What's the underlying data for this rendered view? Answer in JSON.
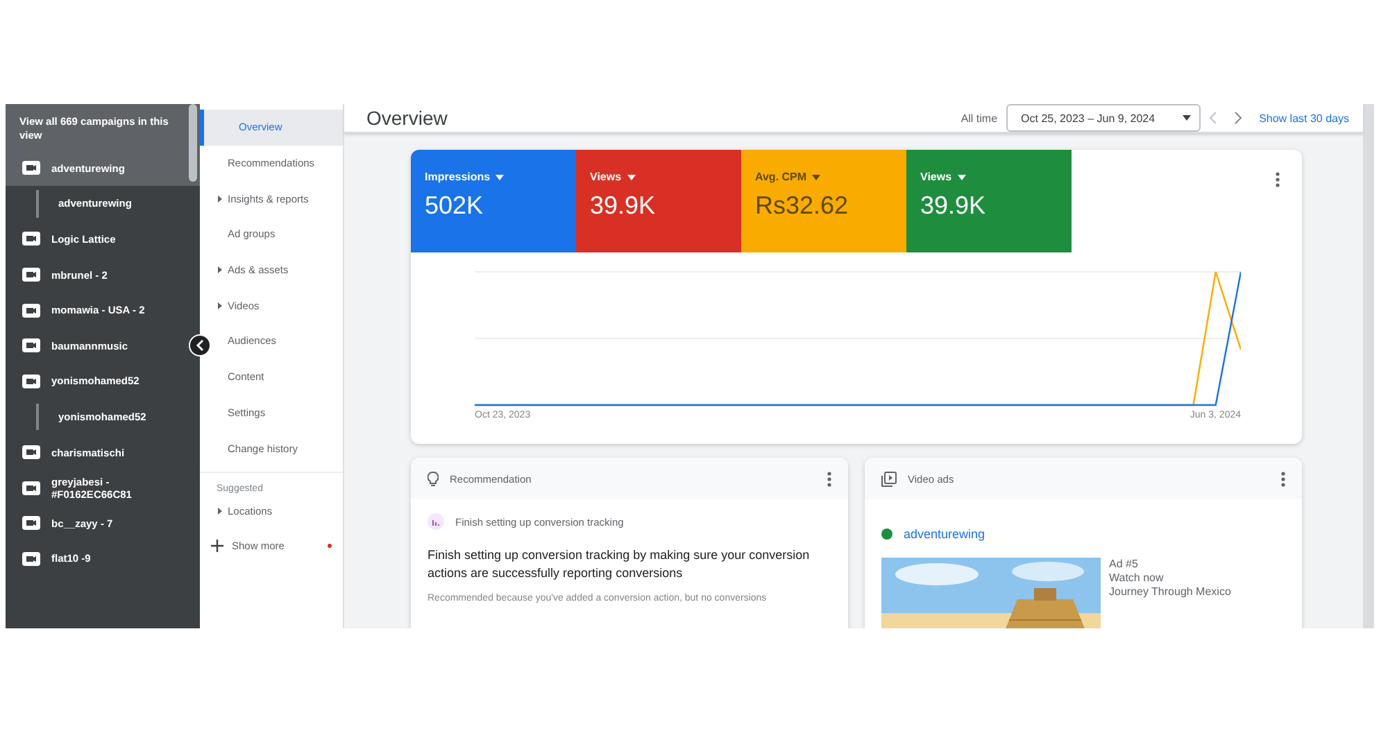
{
  "sidebar": {
    "header": "View all 669 campaigns in this view",
    "items": [
      {
        "kind": "campaign",
        "label": "adventurewing",
        "selected": true
      },
      {
        "kind": "adgroup",
        "label": "adventurewing",
        "selected": false
      },
      {
        "kind": "campaign",
        "label": "Logic Lattice",
        "selected": false
      },
      {
        "kind": "campaign",
        "label": "mbrunel - 2",
        "selected": false
      },
      {
        "kind": "campaign",
        "label": "momawia - USA - 2",
        "selected": false
      },
      {
        "kind": "campaign",
        "label": "baumannmusic",
        "selected": false
      },
      {
        "kind": "campaign",
        "label": "yonismohamed52",
        "selected": false
      },
      {
        "kind": "adgroup",
        "label": "yonismohamed52",
        "selected": false
      },
      {
        "kind": "campaign",
        "label": "charismatischi",
        "selected": false
      },
      {
        "kind": "campaign",
        "label": "greyjabesi - #F0162EC66C81",
        "selected": false
      },
      {
        "kind": "campaign",
        "label": "bc__zayy - 7",
        "selected": false
      },
      {
        "kind": "campaign",
        "label": "flat10 -9",
        "selected": false
      }
    ]
  },
  "nav": {
    "items": [
      {
        "label": "Overview",
        "selected": true,
        "expandable": false
      },
      {
        "label": "Recommendations",
        "selected": false,
        "expandable": false
      },
      {
        "label": "Insights & reports",
        "selected": false,
        "expandable": true
      },
      {
        "label": "Ad groups",
        "selected": false,
        "expandable": false
      },
      {
        "label": "Ads & assets",
        "selected": false,
        "expandable": true
      },
      {
        "label": "Videos",
        "selected": false,
        "expandable": true
      },
      {
        "label": "Audiences",
        "selected": false,
        "expandable": false
      },
      {
        "label": "Content",
        "selected": false,
        "expandable": false
      },
      {
        "label": "Settings",
        "selected": false,
        "expandable": false
      },
      {
        "label": "Change history",
        "selected": false,
        "expandable": false
      }
    ],
    "section": "Suggested",
    "suggested": [
      {
        "label": "Locations",
        "expandable": true
      }
    ],
    "show_more": "Show more"
  },
  "header": {
    "title": "Overview",
    "range_label": "All time",
    "date_range": "Oct 25, 2023 – Jun 9, 2024",
    "show_last": "Show last 30 days"
  },
  "metrics": [
    {
      "label": "Impressions",
      "value": "502K",
      "color": "#1a73e8"
    },
    {
      "label": "Views",
      "value": "39.9K",
      "color": "#d93025"
    },
    {
      "label": "Avg. CPM",
      "value": "Rs32.62",
      "color": "#f9ab00"
    },
    {
      "label": "Views",
      "value": "39.9K",
      "color": "#1e8e3e"
    }
  ],
  "chart": {
    "x_start": "Oct 23, 2023",
    "x_end": "Jun 3, 2024"
  },
  "recommendation": {
    "title": "Recommendation",
    "item": "Finish setting up conversion tracking",
    "headline": "Finish setting up conversion tracking by making sure your conversion actions are successfully reporting conversions",
    "note": "Recommended because you've added a conversion action, but no conversions"
  },
  "video_ads": {
    "title": "Video ads",
    "campaign": "adventurewing",
    "ad_number": "Ad #5",
    "cta": "Watch now",
    "ad_title": "Journey Through Mexico"
  }
}
